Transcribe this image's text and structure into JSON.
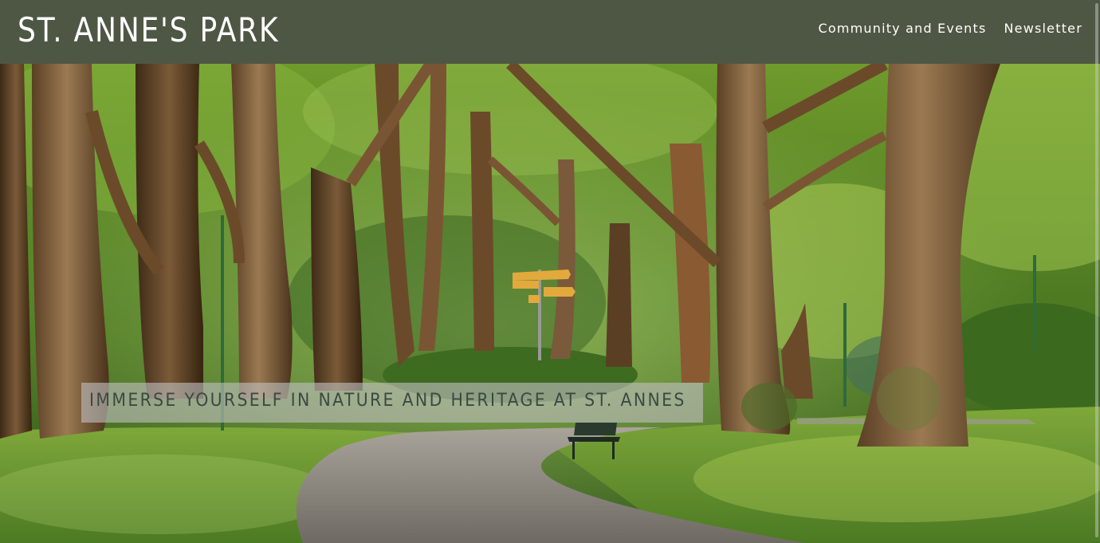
{
  "header": {
    "site_title": "ST. ANNE'S PARK",
    "nav": [
      {
        "label": "Community and Events"
      },
      {
        "label": "Newsletter"
      }
    ]
  },
  "hero": {
    "tagline": "IMMERSE YOURSELF IN NATURE AND HERITAGE AT ST. ANNES",
    "image": "park-avenue-of-trees"
  },
  "colors": {
    "header_bg": "#4e5744",
    "header_text": "#ffffff",
    "tagline_bg": "rgba(190,190,190,0.62)",
    "tagline_text": "#3b4a42"
  }
}
